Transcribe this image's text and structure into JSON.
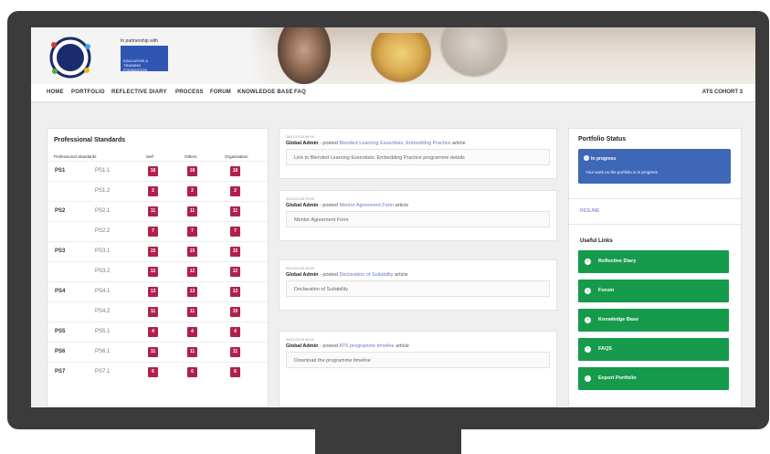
{
  "header": {
    "logo_text": "SOCIETY FOR EDUCATION & TRAINING",
    "partner_label": "In partnership with",
    "partner_logo_text": "EDUCATION & TRAINING FOUNDATION"
  },
  "nav": {
    "items": [
      "HOME",
      "PORTFOLIO",
      "REFLECTIVE DIARY",
      "PROCESS",
      "FORUM",
      "KNOWLEDGE BASE",
      "FAQ"
    ],
    "account": "ATS COHORT 3"
  },
  "standards": {
    "title": "Professional Standards",
    "columns": [
      "Professional Standards",
      "Self",
      "Others",
      "Organisation"
    ],
    "rows": [
      {
        "code": "PS1",
        "sub": "PS1.1",
        "self": "18",
        "others": "18",
        "org": "18"
      },
      {
        "code": "",
        "sub": "PS1.2",
        "self": "2",
        "others": "2",
        "org": "2"
      },
      {
        "code": "PS2",
        "sub": "PS2.1",
        "self": "11",
        "others": "11",
        "org": "11"
      },
      {
        "code": "",
        "sub": "PS2.2",
        "self": "7",
        "others": "7",
        "org": "7"
      },
      {
        "code": "PS3",
        "sub": "PS3.1",
        "self": "15",
        "others": "15",
        "org": "15"
      },
      {
        "code": "",
        "sub": "PS3.2",
        "self": "12",
        "others": "12",
        "org": "12"
      },
      {
        "code": "PS4",
        "sub": "PS4.1",
        "self": "13",
        "others": "13",
        "org": "13"
      },
      {
        "code": "",
        "sub": "PS4.2",
        "self": "11",
        "others": "11",
        "org": "10"
      },
      {
        "code": "PS5",
        "sub": "PS5.1",
        "self": "4",
        "others": "4",
        "org": "4"
      },
      {
        "code": "PS6",
        "sub": "PS6.1",
        "self": "11",
        "others": "11",
        "org": "11"
      },
      {
        "code": "PS7",
        "sub": "PS7.1",
        "self": "6",
        "others": "6",
        "org": "6"
      }
    ]
  },
  "feed": [
    {
      "date": "28/11/2018 09:00",
      "author": "Global Admin",
      "verb": " - posted ",
      "link": "Blended Learning Essentials: Embedding Practice",
      "suffix": " article",
      "body": "Link to Blended Learning Essentials: Embedding Practice programme details"
    },
    {
      "date": "05/12/2018 09:00",
      "author": "Global Admin",
      "verb": " - posted ",
      "link": "Mentor Agreement Form",
      "suffix": " article",
      "body": "Mentor Agreement Form"
    },
    {
      "date": "05/12/2018 09:00",
      "author": "Global Admin",
      "verb": " - posted ",
      "link": "Declaration of Suitability",
      "suffix": " article",
      "body": "Declaration of Suitability"
    },
    {
      "date": "05/11/2018 09:00",
      "author": "Global Admin",
      "verb": " - posted ",
      "link": "ATS programme timeline",
      "suffix": " article",
      "body": "Download the programme timeline"
    }
  ],
  "status": {
    "title": "Portfolio Status",
    "progress_title": "In progress",
    "progress_desc": "Your work on the portfolio is in progress",
    "resume": "RESUME"
  },
  "useful_links": {
    "title": "Useful Links",
    "items": [
      "Reflective Diary",
      "Forum",
      "Knowledge Base",
      "FAQS",
      "Export Portfolio"
    ]
  },
  "colors": {
    "badge": "#b0204b",
    "progress": "#3f67b7",
    "link_button": "#169a4b",
    "accent_link": "#6b79c9"
  }
}
